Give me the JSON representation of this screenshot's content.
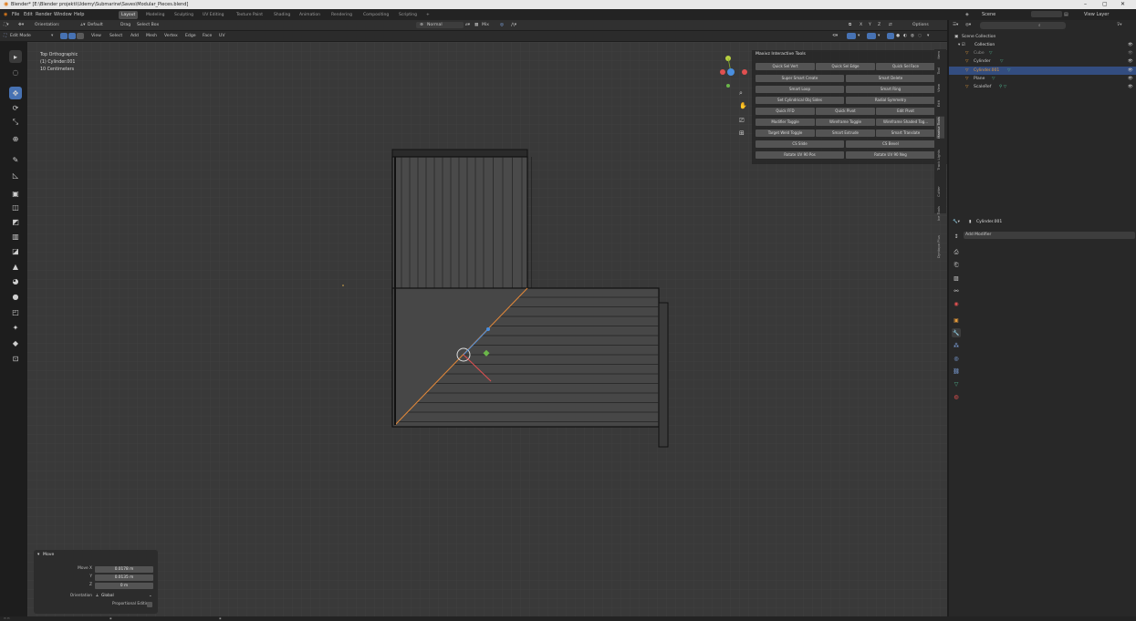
{
  "titlebar": {
    "title": "Blender* [E:\\Blender projekti\\Udemy\\Submarine\\Saves\\Modular_Pieces.blend]",
    "minimize": "–",
    "maximize": "▢",
    "close": "✕"
  },
  "menubar": {
    "menus": [
      "File",
      "Edit",
      "Render",
      "Window",
      "Help"
    ],
    "workspaces": [
      "Layout",
      "Modeling",
      "Sculpting",
      "UV Editing",
      "Texture Paint",
      "Shading",
      "Animation",
      "Rendering",
      "Compositing",
      "Scripting",
      "+"
    ],
    "active_workspace": "Layout",
    "scene_label": "Scene",
    "view_layer_label": "View Layer"
  },
  "header1": {
    "orientation_label": "Orientation:",
    "orientation_value": "Default",
    "drag_label": "Drag",
    "drag_value": "Select Box",
    "normal_label": "Normal",
    "mix_label": "Mix",
    "axes": [
      "X",
      "Y",
      "Z"
    ],
    "options_label": "Options"
  },
  "header2": {
    "mode": "Edit Mode",
    "menus": [
      "View",
      "Select",
      "Add",
      "Mesh",
      "Vertex",
      "Edge",
      "Face",
      "UV"
    ]
  },
  "viewport": {
    "view_name": "Top Orthographic",
    "object_name": "(1) Cylinder.001",
    "scale_label": "10 Centimeters",
    "accent": "#e4893a"
  },
  "npanel": {
    "title": "Maxivz Interactive Tools",
    "rows": [
      [
        "Quick Sel Vert",
        "Quick Sel Edge",
        "Quick Sel Face"
      ],
      [
        "Super Smart Create",
        "Smart Delete"
      ],
      [
        "Smart Loop",
        "Smart Ring"
      ],
      [
        "Set Cylindrical Obj Sides",
        "Radial Symmetry"
      ],
      [
        "Quick FFD",
        "Quick Pivot",
        "Edit Pivot"
      ],
      [
        "Modifier Toggle",
        "Wireframe Toggle",
        "Wireframe Shaded Tog..."
      ],
      [
        "Target Weld Toggle",
        "Smart Extrude",
        "Smart Translate"
      ],
      [
        "CS Slide",
        "CS Bevel"
      ],
      [
        "Rotate UV 90 Pos",
        "Rotate UV 90 Neg"
      ]
    ],
    "tabs": [
      "Item",
      "Tool",
      "View",
      "Edit",
      "Maxivz Tools",
      "Track Lights",
      "Cutter",
      "Ice Tools",
      "Dyntopo Plus"
    ]
  },
  "move_panel": {
    "title": "Move",
    "fields": [
      {
        "label": "Move X",
        "value": "0.0178 m"
      },
      {
        "label": "Y",
        "value": "0.0135 m"
      },
      {
        "label": "Z",
        "value": "0 m"
      }
    ],
    "orientation_label": "Orientation",
    "orientation_value": "Global",
    "proportional_label": "Proportional Editing"
  },
  "outliner": {
    "search_placeholder": "",
    "scene_collection": "Scene Collection",
    "collection": "Collection",
    "items": [
      {
        "name": "Cube",
        "color": "#8a8a8a"
      },
      {
        "name": "Cylinder",
        "color": "#c8c8c8"
      },
      {
        "name": "Cylinder.001",
        "color": "#e49a3a"
      },
      {
        "name": "Plane",
        "color": "#c8c8c8"
      },
      {
        "name": "ScaleRef",
        "color": "#c8c8c8"
      }
    ]
  },
  "properties": {
    "object_name": "Cylinder.001",
    "add_modifier": "Add Modifier"
  },
  "colors": {
    "active_blue": "#4772b3",
    "selected_orange": "#e4893a",
    "panel_bg": "#282828",
    "viewport_bg": "#393939"
  }
}
